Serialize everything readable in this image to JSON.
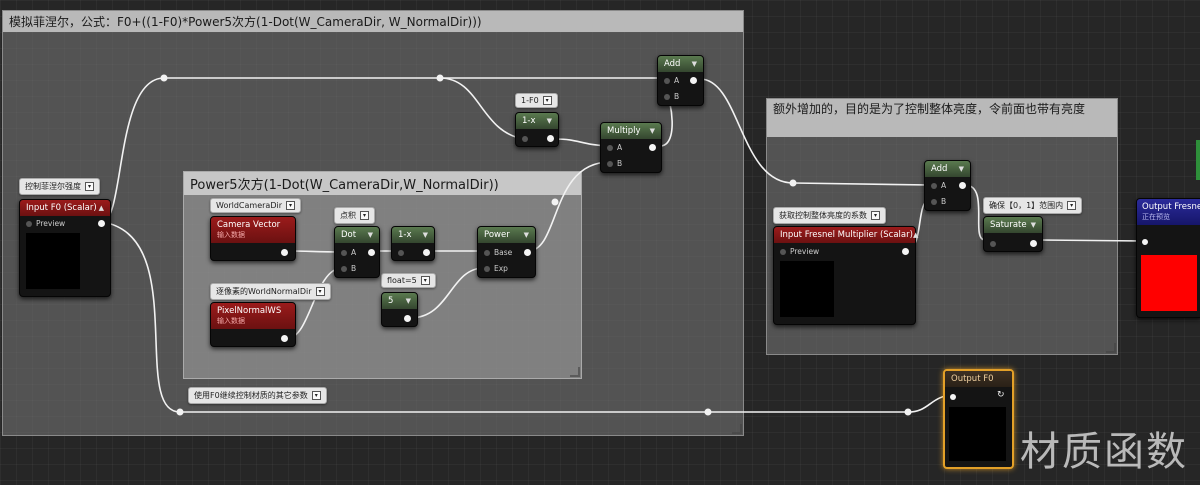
{
  "comments": {
    "main": "模拟菲涅尔，公式：F0+((1-F0)*Power5次方(1-Dot(W_CameraDir, W_NormalDir)))",
    "power5": "Power5次方(1-Dot(W_CameraDir,W_NormalDir))",
    "extra": "额外增加的，目的是为了控制整体亮度，令前面也带有亮度"
  },
  "bubbles": {
    "fresnel_strength": "控制菲涅尔强度",
    "one_minus_f0": "1-F0",
    "world_camera_dir": "WorldCameraDir",
    "dot_product": "点积",
    "pixel_world_normal": "逐像素的WorldNormalDir",
    "float5": "float=5",
    "reuse_f0": "使用F0继续控制材质的其它参数",
    "multiplier_desc": "获取控制整体亮度的系数",
    "clamp_range": "确保【0，1】范围内"
  },
  "nodes": {
    "input_f0": {
      "title": "Input F0 (Scalar)",
      "preview": "Preview"
    },
    "camera_vector": {
      "title": "Camera Vector",
      "sub": "输入数据"
    },
    "pixel_normal": {
      "title": "PixelNormalWS",
      "sub": "输入数据"
    },
    "dot": {
      "title": "Dot",
      "a": "A",
      "b": "B"
    },
    "one_minus_x_a": {
      "title": "1-x"
    },
    "one_minus_x_b": {
      "title": "1-x"
    },
    "power": {
      "title": "Power",
      "base": "Base",
      "exp": "Exp"
    },
    "constant5": {
      "title": "5"
    },
    "multiply": {
      "title": "Multiply",
      "a": "A",
      "b": "B"
    },
    "add1": {
      "title": "Add",
      "a": "A",
      "b": "B"
    },
    "add2": {
      "title": "Add",
      "a": "A",
      "b": "B"
    },
    "fresnel_mult": {
      "title": "Input Fresnel Multiplier (Scalar)",
      "preview": "Preview"
    },
    "saturate": {
      "title": "Saturate"
    },
    "output_fresnel": {
      "title": "Output Fresnel",
      "sub": "正在预览"
    },
    "output_f0": {
      "title": "Output F0"
    }
  },
  "colors": {
    "preview_red": "#ff0000",
    "selection": "#e3a028"
  },
  "watermark": "材质函数"
}
